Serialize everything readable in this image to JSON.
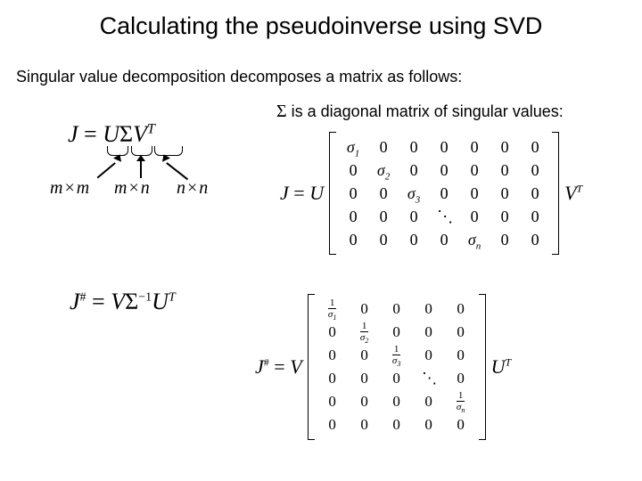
{
  "title": "Calculating the pseudoinverse using SVD",
  "subtitle": "Singular value decomposition decomposes a matrix as follows:",
  "sigma_note_pre_html": "Σ",
  "sigma_note_post": " is a diagonal matrix of singular values:",
  "eq1": {
    "lhs": "J",
    "eq": " = ",
    "U": "U",
    "Sigma": "Σ",
    "V": "V",
    "T": "T"
  },
  "dims": {
    "d1a": "m",
    "d1x": "×",
    "d1b": "m",
    "d2a": "m",
    "d2x": "×",
    "d2b": "n",
    "d3a": "n",
    "d3x": "×",
    "d3b": "n"
  },
  "eq2": {
    "lhs": "J",
    "sharp": "#",
    "eq": " = ",
    "V": "V",
    "Sigma": "Σ",
    "inv": "−1",
    "U": "U",
    "T": "T"
  },
  "mat1": {
    "lhs_J": "J",
    "lhs_eq": " = ",
    "lhs_U": "U",
    "rows": [
      [
        "σ₁",
        "0",
        "0",
        "0",
        "0",
        "0",
        "0"
      ],
      [
        "0",
        "σ₂",
        "0",
        "0",
        "0",
        "0",
        "0"
      ],
      [
        "0",
        "0",
        "σ₃",
        "0",
        "0",
        "0",
        "0"
      ],
      [
        "0",
        "0",
        "0",
        "⋱",
        "0",
        "0",
        "0"
      ],
      [
        "0",
        "0",
        "0",
        "0",
        "σₙ",
        "0",
        "0"
      ]
    ],
    "rhs_V": "V",
    "rhs_T": "T"
  },
  "mat2": {
    "lhs_J": "J",
    "lhs_sharp": "#",
    "lhs_eq": " = ",
    "lhs_V": "V",
    "rows": [
      [
        "1/σ₁",
        "0",
        "0",
        "0",
        "0"
      ],
      [
        "0",
        "1/σ₂",
        "0",
        "0",
        "0"
      ],
      [
        "0",
        "0",
        "1/σ₃",
        "0",
        "0"
      ],
      [
        "0",
        "0",
        "0",
        "⋱",
        "0"
      ],
      [
        "0",
        "0",
        "0",
        "0",
        "1/σₙ"
      ],
      [
        "0",
        "0",
        "0",
        "0",
        "0"
      ]
    ],
    "rhs_U": "U",
    "rhs_T": "T"
  }
}
